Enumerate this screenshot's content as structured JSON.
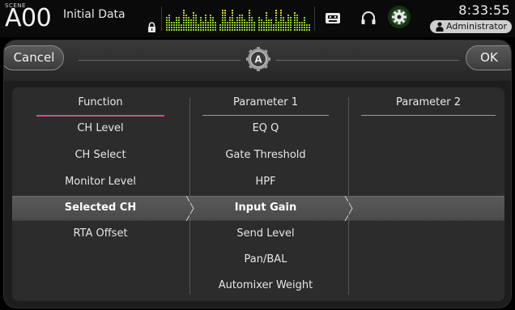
{
  "status_bar": {
    "scene_label": "SCENE",
    "scene_number": "A00",
    "scene_title": "Initial Data",
    "time": "8:33:55",
    "user": "Administrator",
    "meter_colors": {
      "green": "#8fd21a",
      "yellow": "#e8d21a",
      "red": "#e83a1a"
    }
  },
  "popup": {
    "cancel_label": "Cancel",
    "ok_label": "OK",
    "badge_letter": "A",
    "columns": {
      "function": {
        "title": "Function",
        "items": [
          "CH Level",
          "CH Select",
          "Monitor Level",
          "Selected CH",
          "RTA Offset"
        ],
        "selected": "Selected CH"
      },
      "parameter1": {
        "title": "Parameter 1",
        "items": [
          "EQ Q",
          "Gate Threshold",
          "HPF",
          "Input Gain",
          "Send Level",
          "Pan/BAL",
          "Automixer Weight"
        ],
        "selected": "Input Gain"
      },
      "parameter2": {
        "title": "Parameter 2",
        "items": []
      }
    },
    "accent_color": "#c8508a"
  }
}
